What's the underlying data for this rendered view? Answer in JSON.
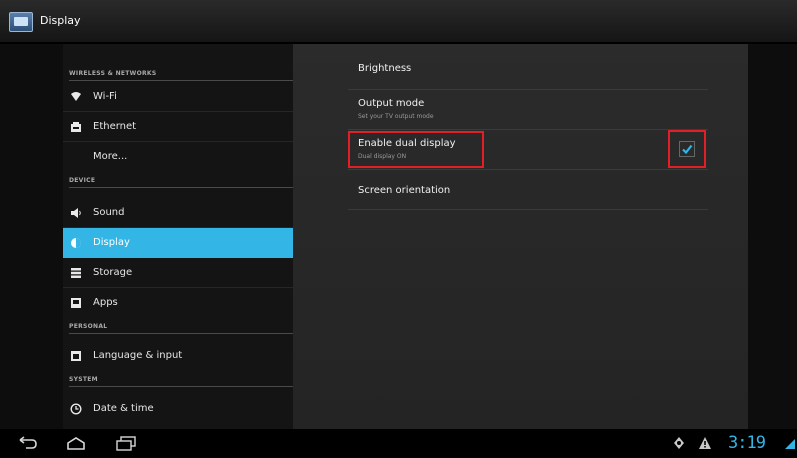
{
  "app": {
    "title": "Display"
  },
  "sidebar": {
    "sections": [
      {
        "header": "WIRELESS & NETWORKS"
      },
      {
        "header": "DEVICE"
      },
      {
        "header": "PERSONAL"
      },
      {
        "header": "SYSTEM"
      }
    ],
    "items": [
      {
        "label": "Wi-Fi",
        "icon": "wifi-icon"
      },
      {
        "label": "Ethernet",
        "icon": "ethernet-icon"
      },
      {
        "label": "More..."
      },
      {
        "label": "Sound",
        "icon": "speaker-icon"
      },
      {
        "label": "Display",
        "icon": "display-icon",
        "selected": true
      },
      {
        "label": "Storage",
        "icon": "storage-icon"
      },
      {
        "label": "Apps",
        "icon": "apps-icon"
      },
      {
        "label": "Language & input",
        "icon": "keyboard-icon"
      },
      {
        "label": "Date & time",
        "icon": "clock-icon"
      }
    ]
  },
  "settings": [
    {
      "title": "Brightness"
    },
    {
      "title": "Output mode",
      "summary": "Set your TV output mode"
    },
    {
      "title": "Enable dual display",
      "summary": "Dual display ON",
      "checked": true,
      "highlighted": true
    },
    {
      "title": "Screen orientation"
    }
  ],
  "status_bar": {
    "time": "3:19"
  },
  "colors": {
    "accent": "#33b5e5",
    "highlight": "#e21f26"
  }
}
